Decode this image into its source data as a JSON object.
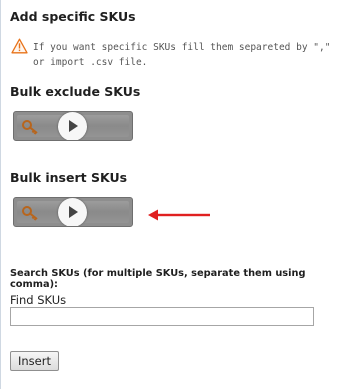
{
  "add_specific": {
    "heading": "Add specific SKUs",
    "warning_icon": "warning-triangle-icon",
    "warning_text": "If you want specific SKUs fill them separeted by \",\" or import .csv file."
  },
  "bulk_exclude": {
    "heading": "Bulk exclude SKUs",
    "video_icon": "play-icon"
  },
  "bulk_insert": {
    "heading": "Bulk insert SKUs",
    "video_icon": "play-icon",
    "annotation": "red-arrow"
  },
  "search": {
    "label": "Search SKUs (for multiple SKUs, separate them using comma):",
    "find_label": "Find SKUs",
    "find_value": ""
  },
  "insert_button": "Insert",
  "colors": {
    "arrow": "#e02020",
    "warning": "#e8731a"
  }
}
